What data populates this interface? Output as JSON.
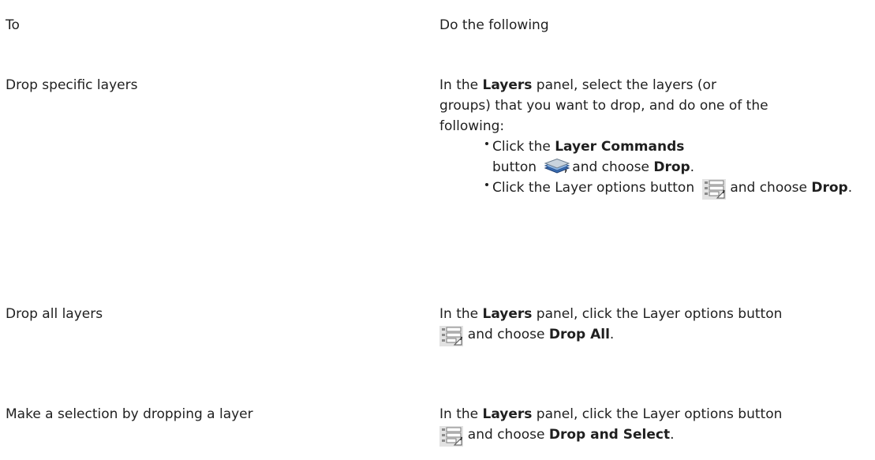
{
  "table": {
    "header_to": "To",
    "header_do": "Do the following"
  },
  "rows": [
    {
      "to": "Drop specific layers",
      "intro_pre": "In the ",
      "intro_bold": "Layers",
      "intro_post": " panel, select the layers (or groups) that you want to drop, and do one of the following:",
      "bullets": [
        {
          "pre": "Click the ",
          "bold": "Layer Commands",
          "mid": " button ",
          "icon": "layer-commands-icon",
          "post": ", and choose ",
          "action": "Drop",
          "end": "."
        },
        {
          "pre": "Click the Layer options button ",
          "icon": "layer-options-icon",
          "post": ", and choose ",
          "action": "Drop",
          "end": "."
        }
      ]
    },
    {
      "to": "Drop all layers",
      "pre": "In the ",
      "bold": "Layers",
      "post": " panel, click the Layer options button",
      "icon": "layer-options-icon",
      "post2": ", and choose ",
      "action": "Drop All",
      "end": "."
    },
    {
      "to": "Make a selection by dropping a layer",
      "pre": "In the ",
      "bold": "Layers",
      "post": " panel, click the Layer options button",
      "icon": "layer-options-icon",
      "post2": ", and choose ",
      "action": "Drop and Select",
      "end": "."
    }
  ]
}
